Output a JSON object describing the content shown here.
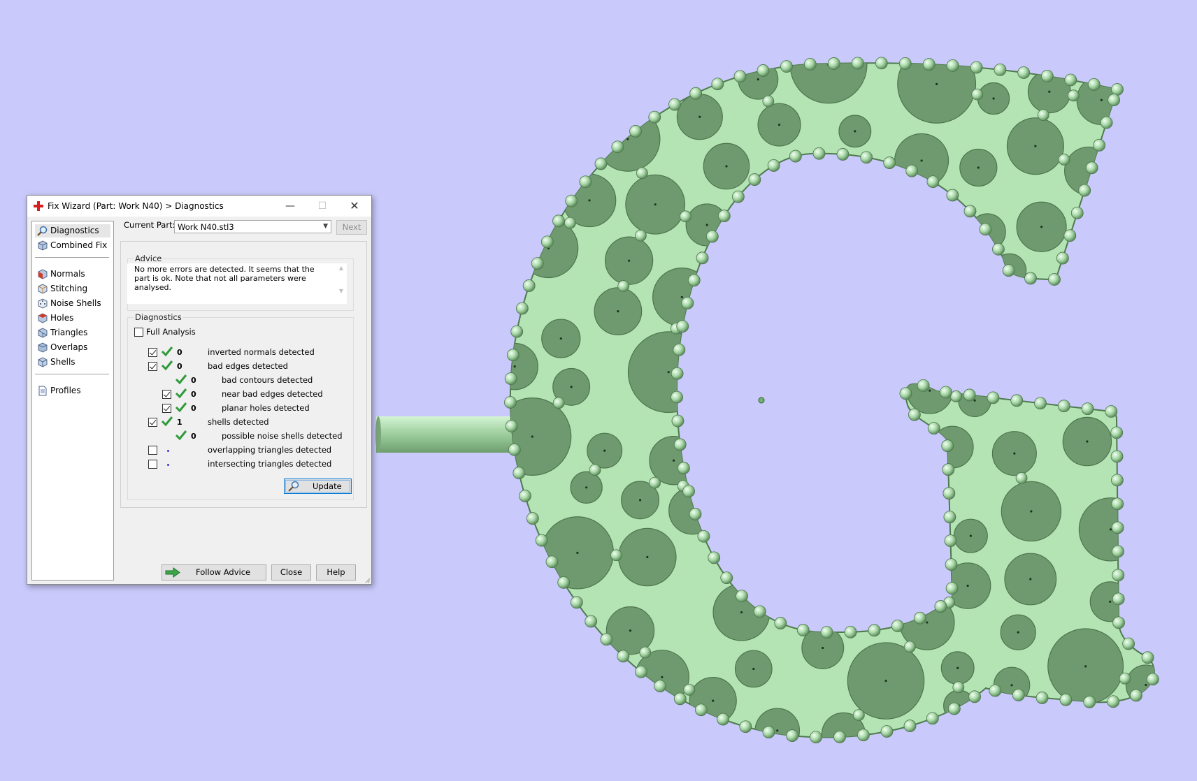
{
  "window": {
    "title": "Fix Wizard (Part: Work N40) > Diagnostics",
    "minimize_glyph": "—",
    "maximize_glyph": "☐",
    "close_glyph": "✕"
  },
  "nav": {
    "items": [
      {
        "label": "Diagnostics",
        "icon": "magnifier-icon"
      },
      {
        "label": "Combined Fix",
        "icon": "cube-icon"
      },
      {
        "label": "Normals",
        "icon": "cube-red-face-icon"
      },
      {
        "label": "Stitching",
        "icon": "cube-icon"
      },
      {
        "label": "Noise Shells",
        "icon": "dice-icon"
      },
      {
        "label": "Holes",
        "icon": "cube-red-face-icon"
      },
      {
        "label": "Triangles",
        "icon": "cube-icon"
      },
      {
        "label": "Overlaps",
        "icon": "cube-icon"
      },
      {
        "label": "Shells",
        "icon": "cube-icon"
      },
      {
        "label": "Profiles",
        "icon": "document-icon"
      }
    ]
  },
  "current_part": {
    "label": "Current Part:",
    "value": "Work N40.stl3",
    "next_label": "Next"
  },
  "advice": {
    "title": "Advice",
    "text": "No more errors are detected. It seems that the part is ok. Note that not all parameters were analysed."
  },
  "diagnostics": {
    "title": "Diagnostics",
    "full_analysis_label": "Full Analysis",
    "full_analysis_checked": false,
    "rows": [
      {
        "checkbox": true,
        "checked": true,
        "status": "ok",
        "count": "0",
        "label": "inverted normals detected",
        "indent": 0
      },
      {
        "checkbox": true,
        "checked": true,
        "status": "ok",
        "count": "0",
        "label": "bad edges detected",
        "indent": 0
      },
      {
        "checkbox": false,
        "checked": false,
        "status": "ok",
        "count": "0",
        "label": "bad contours detected",
        "indent": 1
      },
      {
        "checkbox": true,
        "checked": true,
        "status": "ok",
        "count": "0",
        "label": "near bad edges detected",
        "indent": 1
      },
      {
        "checkbox": true,
        "checked": true,
        "status": "ok",
        "count": "0",
        "label": "planar holes detected",
        "indent": 1
      },
      {
        "checkbox": true,
        "checked": true,
        "status": "ok",
        "count": "1",
        "label": "shells detected",
        "indent": 0
      },
      {
        "checkbox": false,
        "checked": false,
        "status": "ok",
        "count": "0",
        "label": "possible noise shells detected",
        "indent": 1
      },
      {
        "checkbox": true,
        "checked": false,
        "status": "not-run",
        "count": "",
        "label": "overlapping triangles detected",
        "indent": 0
      },
      {
        "checkbox": true,
        "checked": false,
        "status": "not-run",
        "count": "",
        "label": "intersecting triangles detected",
        "indent": 0
      }
    ],
    "update_label": "Update"
  },
  "buttons": {
    "follow_advice": "Follow Advice",
    "close": "Close",
    "help": "Help"
  },
  "colors": {
    "background": "#c9c9fb",
    "part_fill": "#6f9a6f",
    "part_rim": "#a9dba9",
    "check_green": "#2f9a3a",
    "accent_blue": "#0078d7"
  }
}
